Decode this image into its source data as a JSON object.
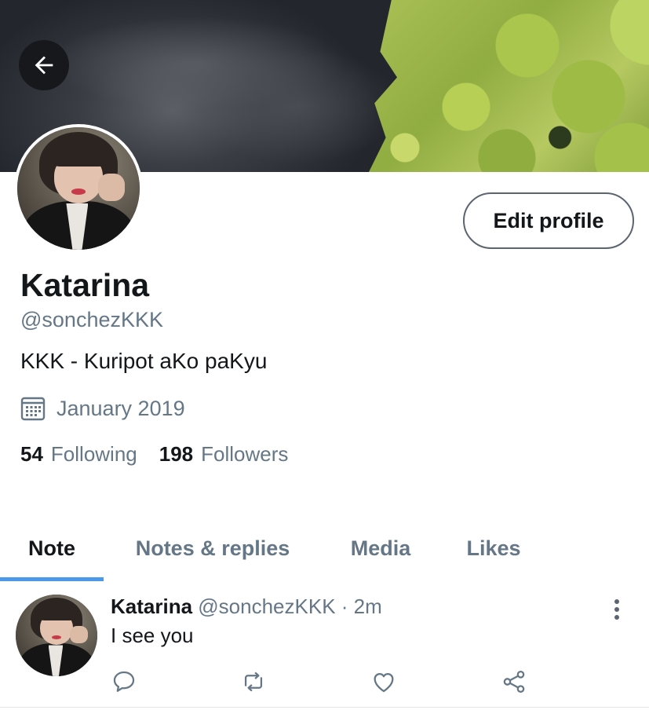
{
  "profile": {
    "name": "Katarina",
    "handle": "@sonchezKKK",
    "bio": "KKK - Kuripot aKo paKyu",
    "joined": "January 2019",
    "following_count": "54",
    "following_label": "Following",
    "followers_count": "198",
    "followers_label": "Followers"
  },
  "header": {
    "back_icon": "arrow-left-icon",
    "edit_button_label": "Edit profile"
  },
  "tabs": [
    {
      "label": "Note",
      "active": true
    },
    {
      "label": "Notes & replies",
      "active": false
    },
    {
      "label": "Media",
      "active": false
    },
    {
      "label": "Likes",
      "active": false
    }
  ],
  "post": {
    "name": "Katarina",
    "handle": "@sonchezKKK",
    "time": "· 2m",
    "text": "I see you",
    "actions": [
      "reply-icon",
      "renote-icon",
      "like-icon",
      "share-icon"
    ]
  },
  "colors": {
    "secondary_text": "#657786",
    "accent": "#4a99e9",
    "primary_text": "#14171a"
  }
}
